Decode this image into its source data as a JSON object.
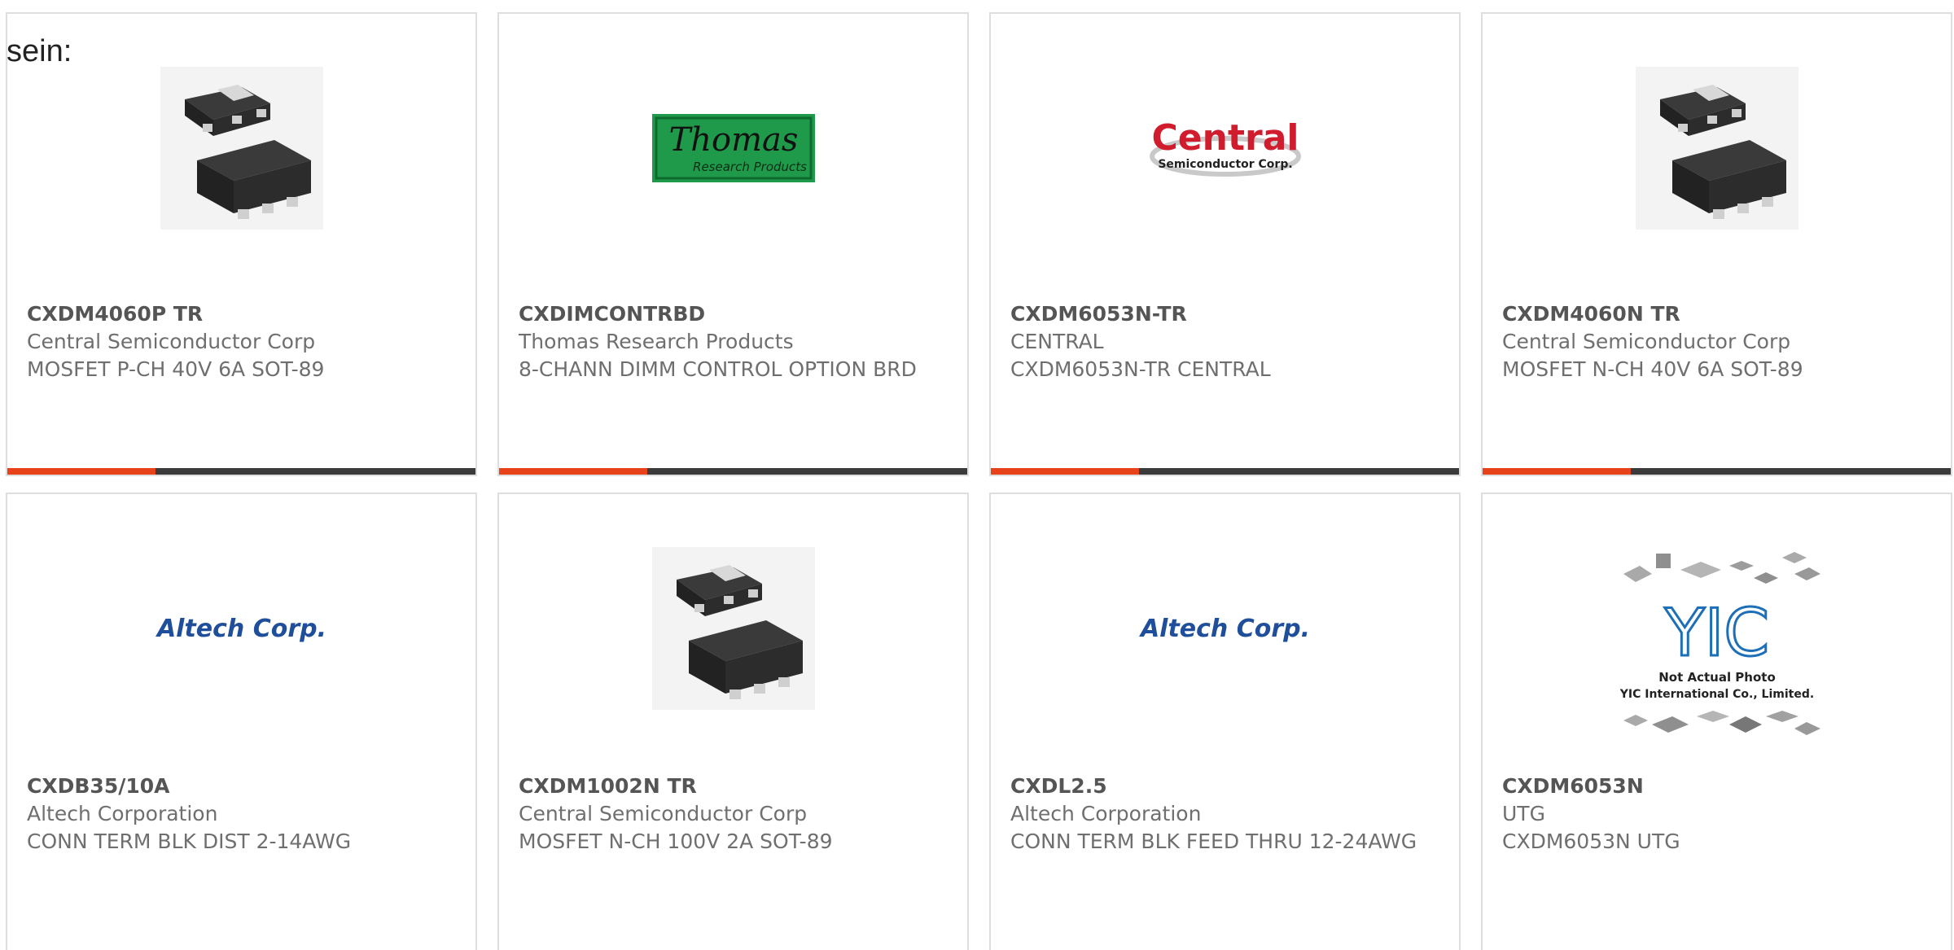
{
  "lead_text": "sein:",
  "accent_color": "#e8421b",
  "bar_color": "#3b3b3b",
  "cards": [
    {
      "part_number": "CXDM4060P TR",
      "manufacturer": "Central Semiconductor Corp",
      "description": "MOSFET P-CH 40V 6A SOT-89",
      "image": "sot89-package-icon"
    },
    {
      "part_number": "CXDIMCONTRBD",
      "manufacturer": "Thomas Research Products",
      "description": "8-CHANN DIMM CONTROL OPTION BRD",
      "image": "thomas-logo",
      "logo_main": "Thomas",
      "logo_sub": "Research Products"
    },
    {
      "part_number": "CXDM6053N-TR",
      "manufacturer": "CENTRAL",
      "description": "CXDM6053N-TR CENTRAL",
      "image": "central-logo",
      "logo_main": "Central",
      "logo_sub": "Semiconductor Corp."
    },
    {
      "part_number": "CXDM4060N TR",
      "manufacturer": "Central Semiconductor Corp",
      "description": "MOSFET N-CH 40V 6A SOT-89",
      "image": "sot89-package-icon"
    },
    {
      "part_number": "CXDB35/10A",
      "manufacturer": "Altech Corporation",
      "description": "CONN TERM BLK DIST 2-14AWG",
      "image": "altech-logo",
      "logo_main": "Altech Corp."
    },
    {
      "part_number": "CXDM1002N TR",
      "manufacturer": "Central Semiconductor Corp",
      "description": "MOSFET N-CH 100V 2A SOT-89",
      "image": "sot89-package-icon"
    },
    {
      "part_number": "CXDL2.5",
      "manufacturer": "Altech Corporation",
      "description": "CONN TERM BLK FEED THRU 12-24AWG",
      "image": "altech-logo",
      "logo_main": "Altech Corp."
    },
    {
      "part_number": "CXDM6053N",
      "manufacturer": "UTG",
      "description": "CXDM6053N UTG",
      "image": "yic-placeholder",
      "logo_main": "YIC",
      "logo_line1": "Not Actual Photo",
      "logo_line2": "YIC International Co., Limited."
    }
  ]
}
